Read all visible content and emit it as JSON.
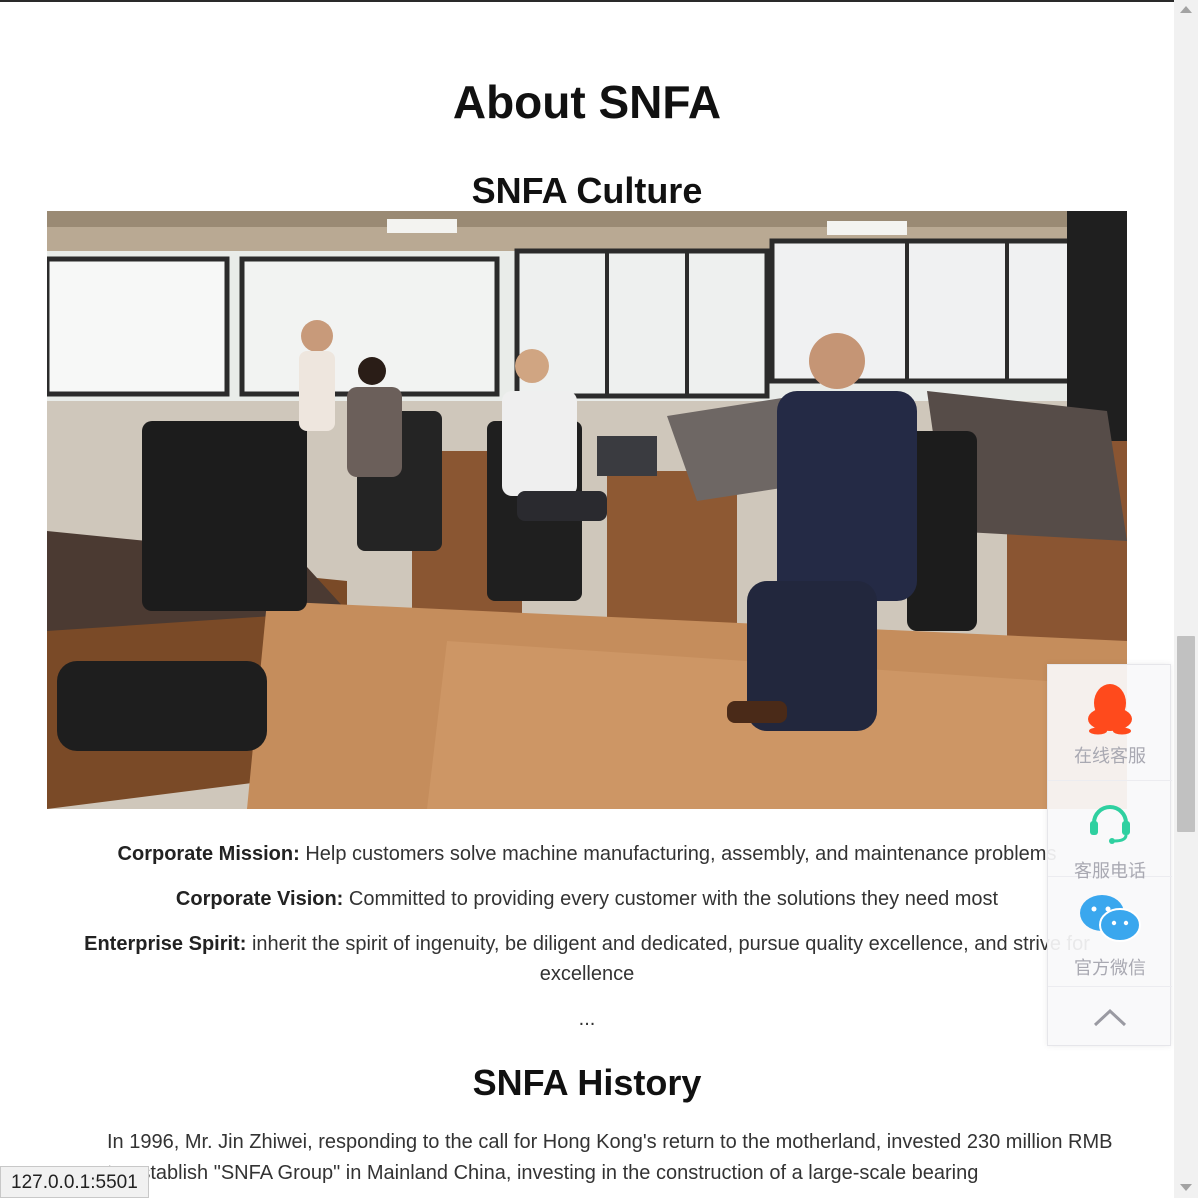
{
  "page": {
    "title": "About SNFA"
  },
  "culture": {
    "title": "SNFA Culture",
    "mission_label": "Corporate Mission:",
    "mission_text": " Help customers solve machine manufacturing, assembly, and maintenance problems",
    "vision_label": "Corporate Vision:",
    "vision_text": " Committed to providing every customer with the solutions they need most",
    "spirit_label": "Enterprise Spirit:",
    "spirit_text": " inherit the spirit of ingenuity, be diligent and dedicated, pursue quality excellence, and strive for excellence",
    "ellipsis": "..."
  },
  "history": {
    "title": "SNFA History",
    "text": "In 1996, Mr. Jin Zhiwei, responding to the call for Hong Kong's return to the motherland, invested 230 million RMB to establish \"SNFA Group\" in Mainland China, investing in the construction of a large-scale bearing"
  },
  "float_bar": {
    "online_service": "在线客服",
    "service_phone": "客服电话",
    "official_wechat": "官方微信",
    "qq_color": "#ff4a1c",
    "phone_color": "#2fd0a0",
    "wechat_color": "#3aa7ee"
  },
  "status_bar": {
    "url": "127.0.0.1:5501"
  }
}
